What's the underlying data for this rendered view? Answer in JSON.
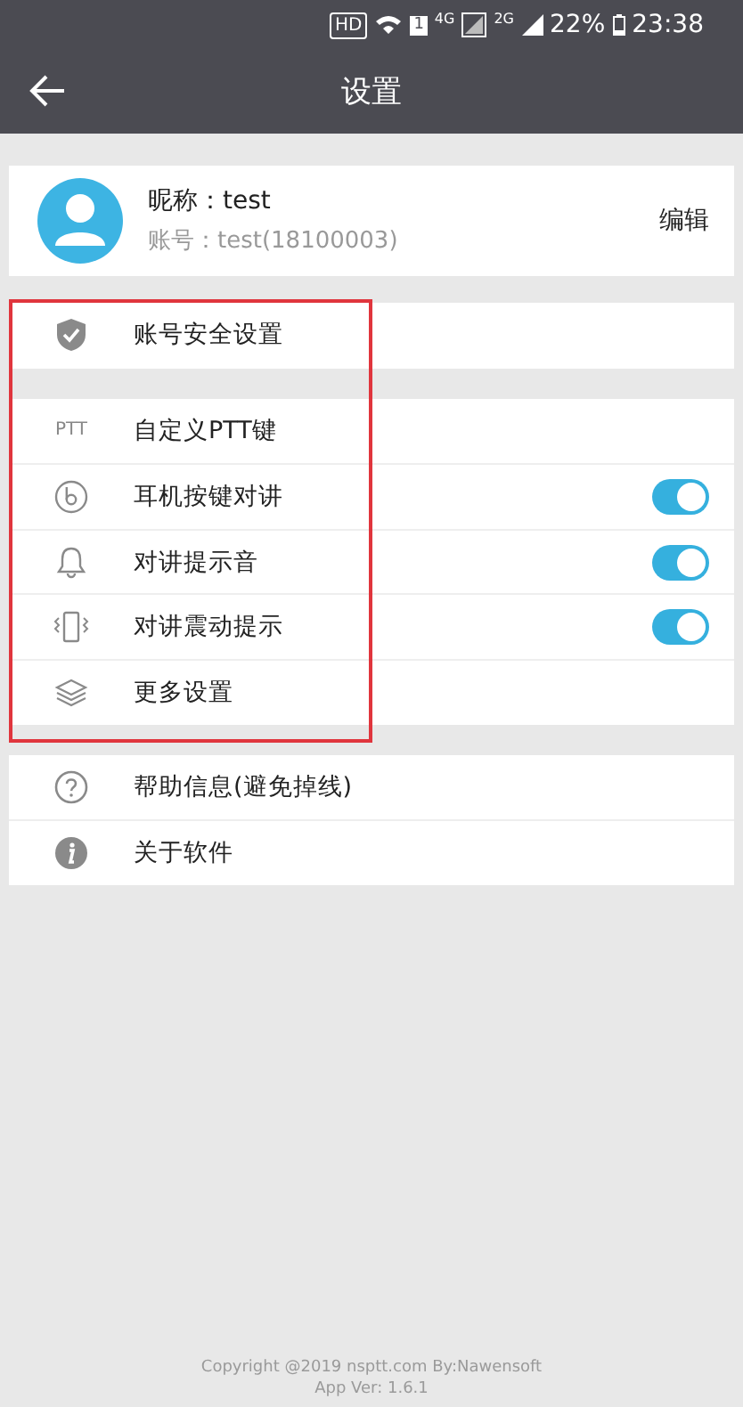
{
  "status_bar": {
    "hd": "HD",
    "sim": "1",
    "network_1": "4G",
    "network_2": "2G",
    "battery": "22%",
    "time": "23:38"
  },
  "header": {
    "title": "设置"
  },
  "profile": {
    "nickname": "昵称：test",
    "account": "账号：test(18100003)",
    "edit": "编辑"
  },
  "groups": [
    {
      "items": [
        {
          "kind": "plain",
          "label": "账号安全设置"
        }
      ]
    },
    {
      "items": [
        {
          "kind": "plain",
          "label": "自定义PTT键",
          "icon_text": "PTT"
        },
        {
          "kind": "toggle",
          "label": "耳机按键对讲",
          "on": true
        },
        {
          "kind": "toggle",
          "label": "对讲提示音",
          "on": true
        },
        {
          "kind": "toggle",
          "label": "对讲震动提示",
          "on": true
        },
        {
          "kind": "plain",
          "label": "更多设置"
        }
      ]
    },
    {
      "items": [
        {
          "kind": "plain",
          "label": "帮助信息(避免掉线)"
        },
        {
          "kind": "plain",
          "label": "关于软件"
        }
      ]
    }
  ],
  "footer": {
    "copyright": "Copyright @2019 nsptt.com By:Nawensoft",
    "version": "App Ver: 1.6.1"
  }
}
